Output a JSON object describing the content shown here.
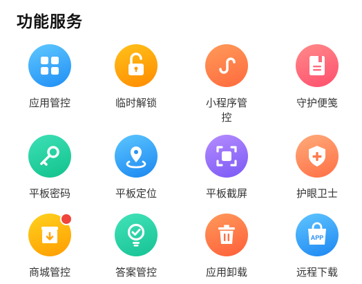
{
  "section": {
    "title": "功能服务"
  },
  "tiles": [
    {
      "label": "应用管控",
      "icon": "grid-apps-icon",
      "gradient": [
        "#5fc8ff",
        "#1f8ef5"
      ]
    },
    {
      "label": "临时解锁",
      "icon": "unlock-icon",
      "gradient": [
        "#ffc21a",
        "#ff8a00"
      ]
    },
    {
      "label": "小程序管控",
      "icon": "mini-program-icon",
      "gradient": [
        "#ff9a5a",
        "#ff6a3d"
      ]
    },
    {
      "label": "守护便笺",
      "icon": "notebook-icon",
      "gradient": [
        "#ff8a8a",
        "#ff4f6d"
      ]
    },
    {
      "label": "平板密码",
      "icon": "key-icon",
      "gradient": [
        "#3de0b6",
        "#12c28c"
      ]
    },
    {
      "label": "平板定位",
      "icon": "location-pin-icon",
      "gradient": [
        "#5cc6ff",
        "#1a86f0"
      ]
    },
    {
      "label": "平板截屏",
      "icon": "screenshot-icon",
      "gradient": [
        "#b58cff",
        "#7a58f5"
      ]
    },
    {
      "label": "护眼卫士",
      "icon": "shield-plus-icon",
      "gradient": [
        "#ffab7a",
        "#ff6f45"
      ]
    },
    {
      "label": "商城管控",
      "icon": "store-box-icon",
      "gradient": [
        "#ffd21e",
        "#ff9c00"
      ],
      "badge": true
    },
    {
      "label": "答案管控",
      "icon": "check-bulb-icon",
      "gradient": [
        "#42e3b8",
        "#16c294"
      ]
    },
    {
      "label": "应用卸载",
      "icon": "trash-icon",
      "gradient": [
        "#ff9a5a",
        "#ff5e3a"
      ]
    },
    {
      "label": "远程下载",
      "icon": "app-bag-icon",
      "gradient": [
        "#60c6ff",
        "#1c86f2"
      ],
      "app_text": "APP"
    }
  ],
  "colors": {
    "badge": "#f0453a"
  }
}
